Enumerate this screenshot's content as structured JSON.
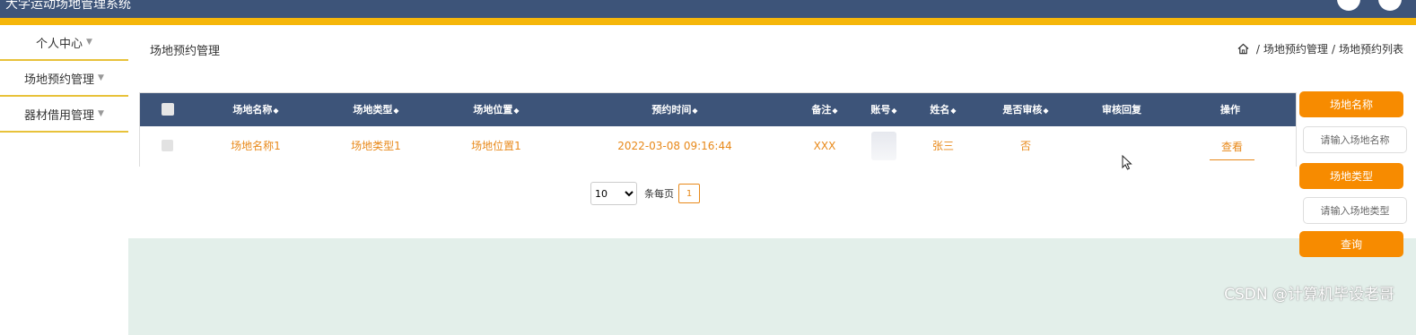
{
  "app": {
    "title": "大学运动场地管理系统"
  },
  "sidebar": {
    "items": [
      {
        "label": "个人中心"
      },
      {
        "label": "场地预约管理"
      },
      {
        "label": "器材借用管理"
      }
    ]
  },
  "page": {
    "title": "场地预约管理",
    "breadcrumb": [
      "场地预约管理",
      "场地预约列表"
    ]
  },
  "table": {
    "columns": [
      {
        "label": "场地名称",
        "sortable": true
      },
      {
        "label": "场地类型",
        "sortable": true
      },
      {
        "label": "场地位置",
        "sortable": true
      },
      {
        "label": "预约时间",
        "sortable": true
      },
      {
        "label": "备注",
        "sortable": true
      },
      {
        "label": "账号",
        "sortable": true
      },
      {
        "label": "姓名",
        "sortable": true
      },
      {
        "label": "是否审核",
        "sortable": true
      },
      {
        "label": "审核回复",
        "sortable": false
      },
      {
        "label": "操作",
        "sortable": false
      }
    ],
    "rows": [
      {
        "venue_name": "场地名称1",
        "venue_type": "场地类型1",
        "venue_location": "场地位置1",
        "booking_time": "2022-03-08 09:16:44",
        "remark": "XXX",
        "account": "",
        "name": "张三",
        "reviewed": "否",
        "review_reply": "",
        "action": "查看"
      }
    ]
  },
  "pagination": {
    "page_size": "10",
    "page_size_options": [
      "10"
    ],
    "per_page_label": "条每页",
    "current_page": "1"
  },
  "filters": {
    "venue_name_label": "场地名称",
    "venue_name_placeholder": "请输入场地名称",
    "venue_type_label": "场地类型",
    "venue_type_placeholder": "请输入场地类型",
    "query_label": "查询"
  },
  "watermark": "CSDN @计算机毕设老哥",
  "colors": {
    "header": "#3d5479",
    "accent": "#f5b60a",
    "orange": "#f78b00",
    "link": "#e8891a",
    "content_bg": "#e3efea"
  }
}
